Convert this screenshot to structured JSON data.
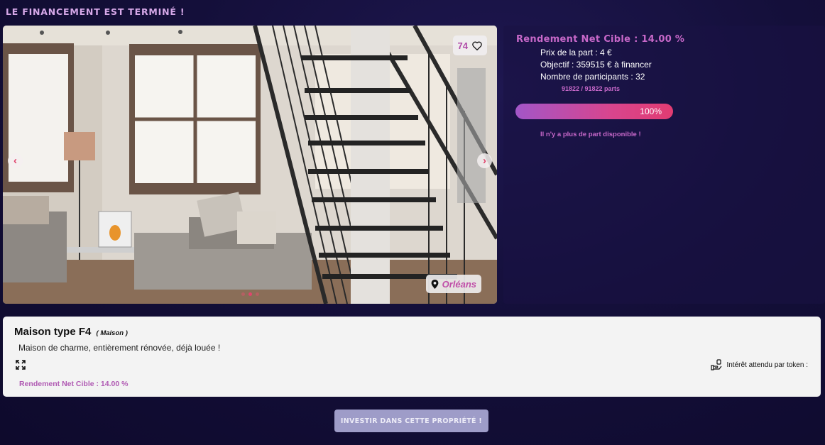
{
  "banner": "LE FINANCEMENT EST TERMINÉ !",
  "photo": {
    "likes": "74",
    "location": "Orléans",
    "slides": 3,
    "active_slide": 2
  },
  "summary": {
    "yield_title": "Rendement Net Cible : 14.00 %",
    "price": "Prix de la part : 4 €",
    "objective": "Objectif : 359515 € à financer",
    "participants": "Nombre de participants : 32",
    "parts": "91822 / 91822 parts",
    "progress_label": "100%",
    "progress_value": 1.0,
    "no_parts": "Il n'y a plus de part disponible !"
  },
  "property": {
    "title": "Maison type F4",
    "type": "( Maison )",
    "description": "Maison de charme, entièrement rénovée, déjà louée !",
    "token_interest": "Intérêt attendu par token :",
    "yield": "Rendement Net Cible : 14.00 %"
  },
  "invest_button": "INVESTIR DANS CETTE PROPRIÉTÉ !",
  "colors": {
    "accent": "#c768c9",
    "progress_start": "#a256c8",
    "progress_end": "#e23c72",
    "background": "#140f3a"
  }
}
